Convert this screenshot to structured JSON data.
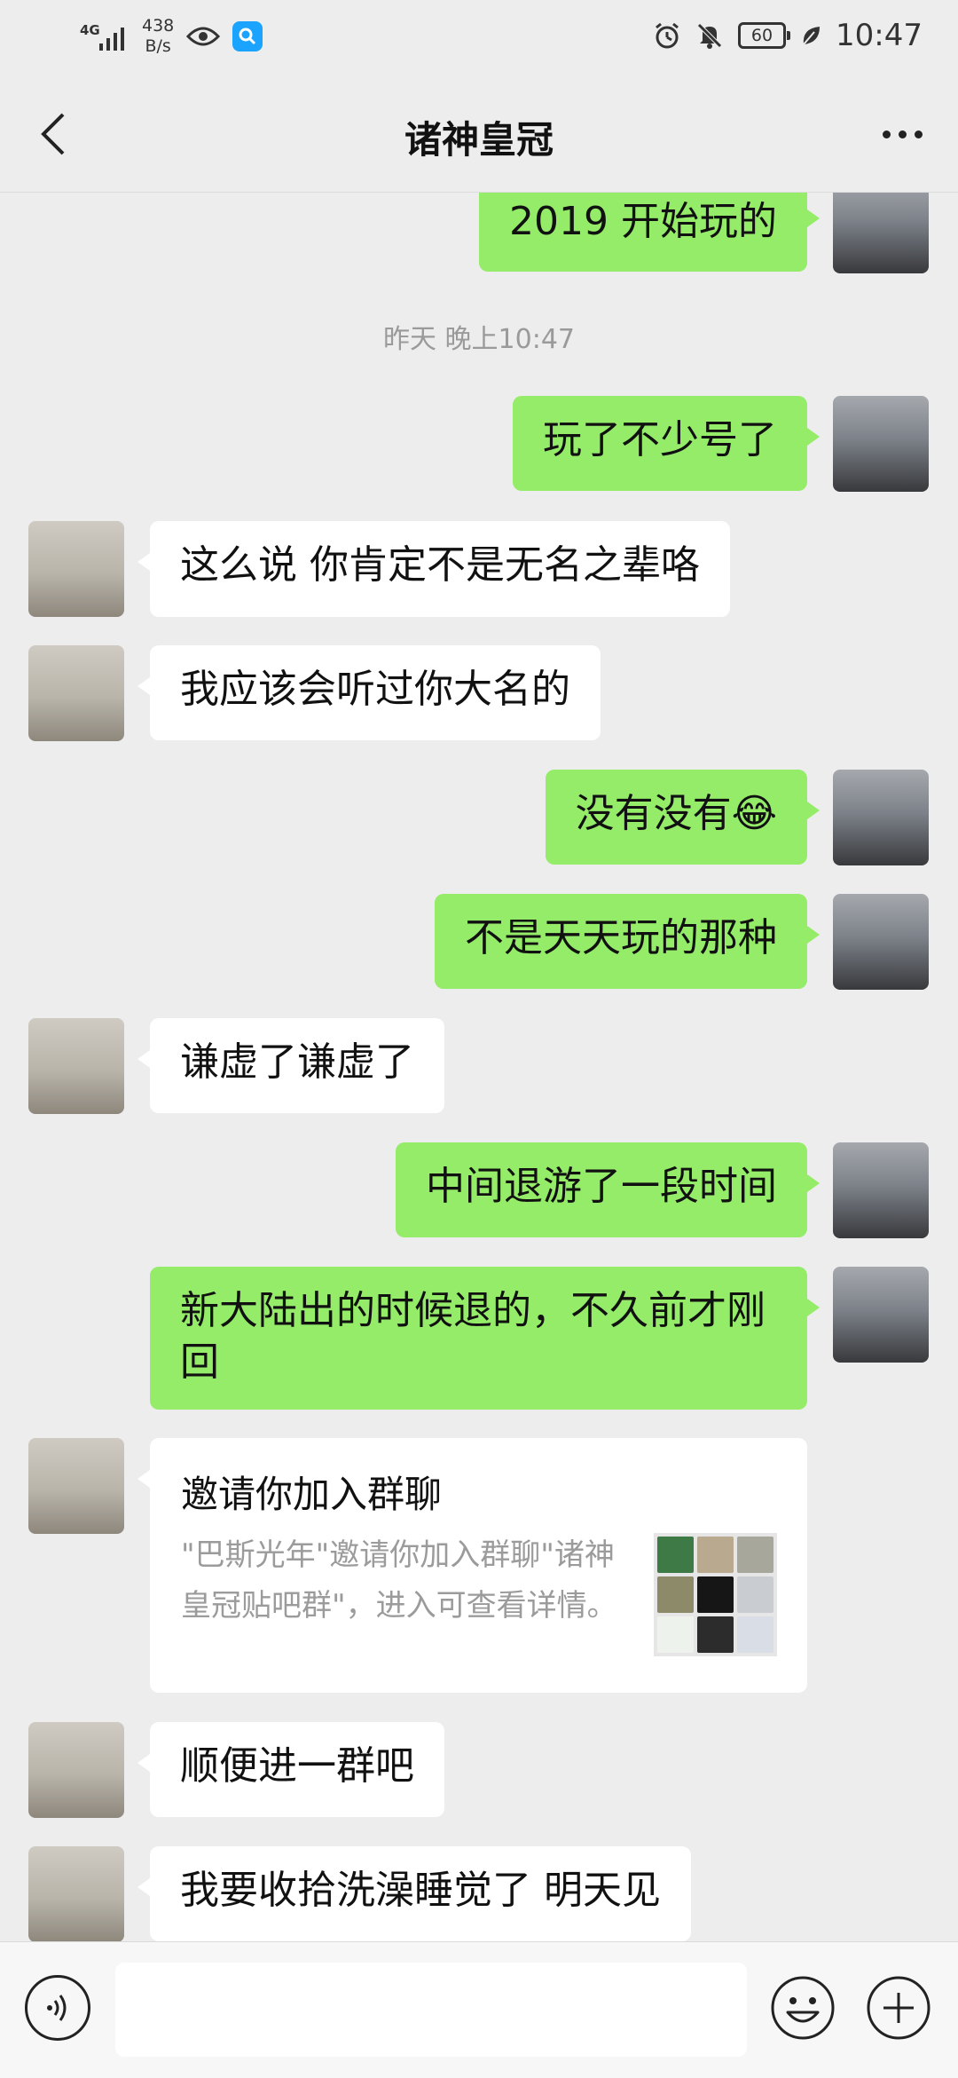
{
  "status_bar": {
    "network": "4G",
    "speed_value": "438",
    "speed_unit": "B/s",
    "battery": "60",
    "time": "10:47",
    "icons": [
      "signal-icon",
      "eye-icon",
      "search-app-icon",
      "alarm-icon",
      "mute-icon",
      "battery-icon",
      "leaf-icon"
    ]
  },
  "header": {
    "title": "诸神皇冠",
    "back_icon": "chevron-left-icon",
    "more_icon": "more-icon"
  },
  "messages": [
    {
      "from": "me",
      "text": "2019 开始玩的"
    },
    {
      "type": "timestamp",
      "text": "昨天 晚上10:47"
    },
    {
      "from": "me",
      "text": "玩了不少号了"
    },
    {
      "from": "other",
      "text": "这么说 你肯定不是无名之辈咯"
    },
    {
      "from": "other",
      "text": "我应该会听过你大名的"
    },
    {
      "from": "me",
      "text": "没有没有😂"
    },
    {
      "from": "me",
      "text": "不是天天玩的那种"
    },
    {
      "from": "other",
      "text": "谦虚了谦虚了"
    },
    {
      "from": "me",
      "text": "中间退游了一段时间"
    },
    {
      "from": "me",
      "text": "新大陆出的时候退的，不久前才刚回"
    },
    {
      "from": "other",
      "type": "card",
      "title": "邀请你加入群聊",
      "description": "\"巴斯光年\"邀请你加入群聊\"诸神皇冠贴吧群\"，进入可查看详情。"
    },
    {
      "from": "other",
      "text": "顺便进一群吧"
    },
    {
      "from": "other",
      "text": "我要收拾洗澡睡觉了 明天见"
    }
  ],
  "input_bar": {
    "placeholder": "",
    "icons": [
      "voice-icon",
      "emoji-icon",
      "plus-icon"
    ]
  },
  "colors": {
    "background": "#ededed",
    "my_bubble": "#95ec69",
    "other_bubble": "#ffffff",
    "timestamp_text": "#9a9a9a"
  }
}
